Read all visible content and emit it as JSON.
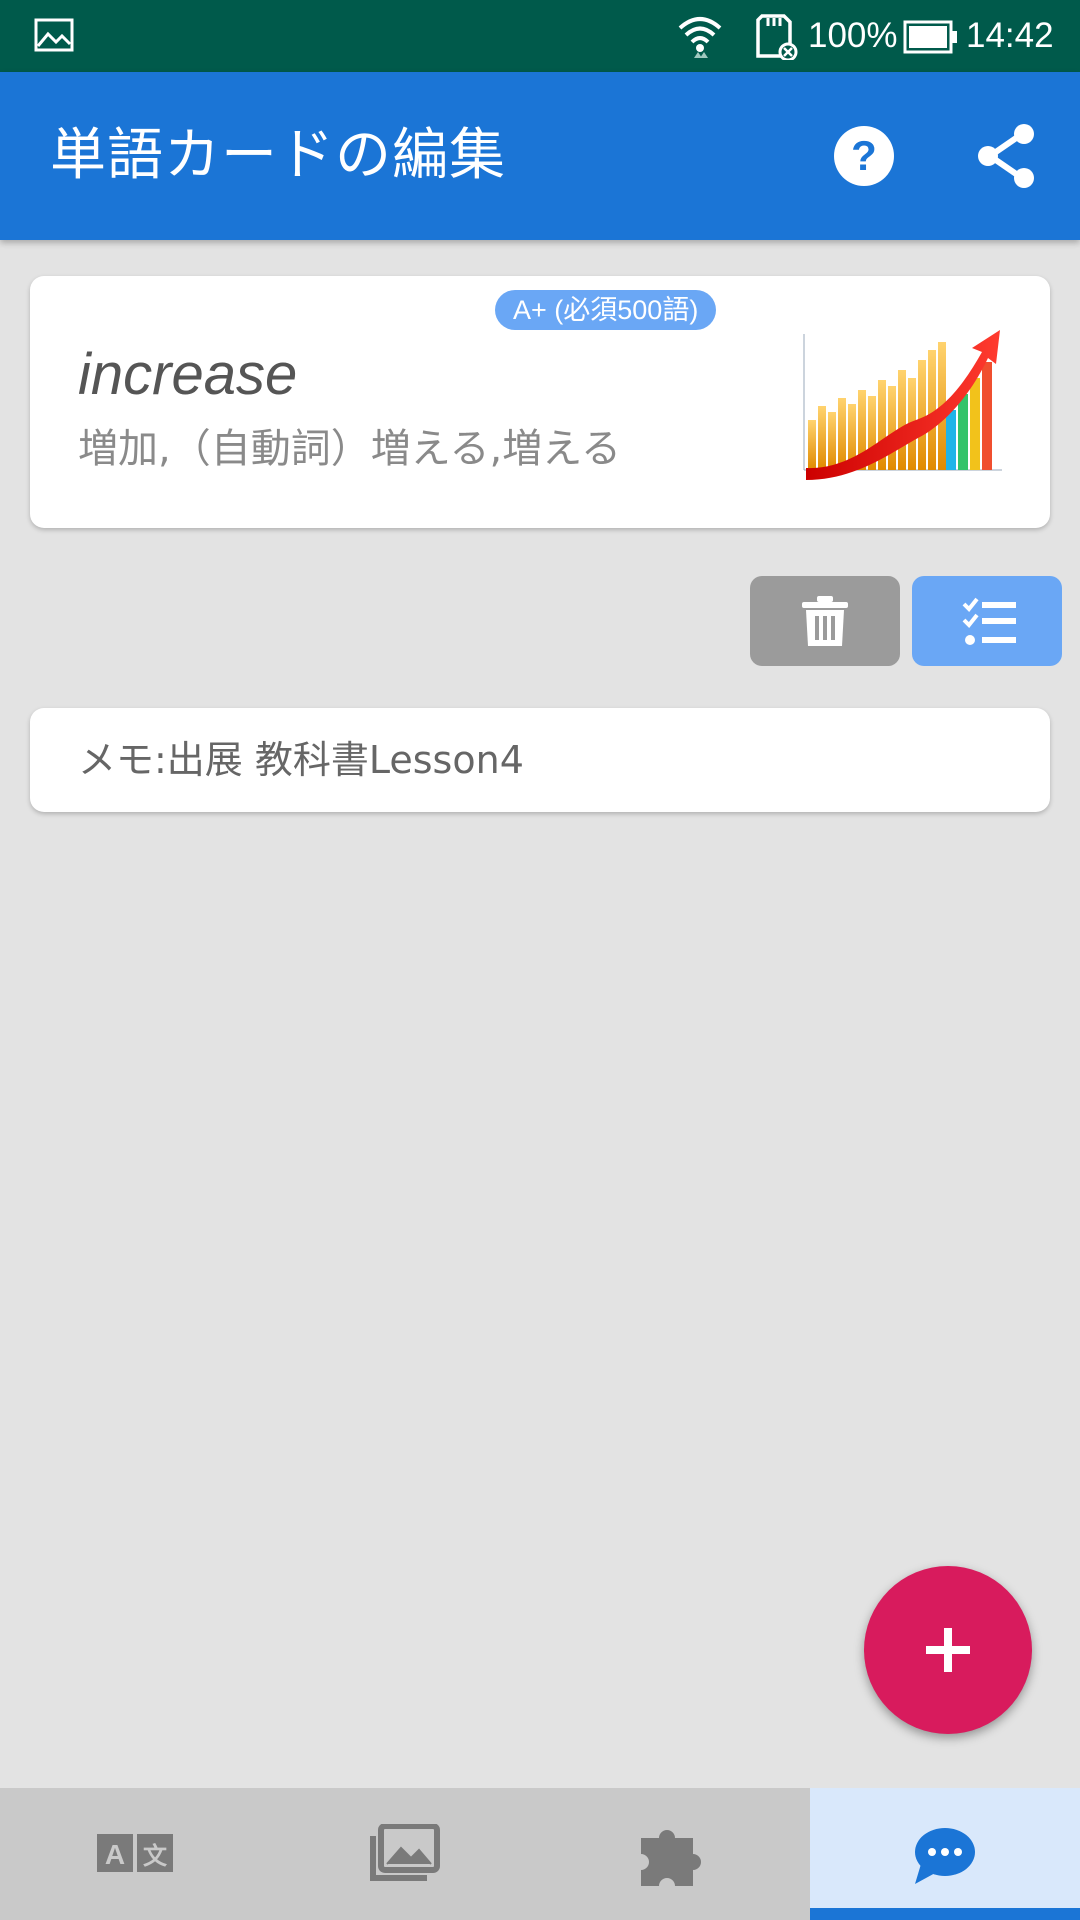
{
  "status_bar": {
    "battery_percent": "100%",
    "time": "14:42",
    "icons": [
      "gallery-icon",
      "wifi-icon",
      "sd-card-icon",
      "battery-icon"
    ]
  },
  "app_bar": {
    "title": "単語カードの編集",
    "icons": [
      "help-icon",
      "share-icon"
    ]
  },
  "word_card": {
    "badge": "A+ (必須500語)",
    "word": "increase",
    "meaning": "増加,（自動詞）増える,増える",
    "image": "growth-chart-image"
  },
  "actions": {
    "delete_icon": "trash-icon",
    "list_icon": "checklist-icon"
  },
  "memo": {
    "text": "メモ:出展 教科書Lesson4"
  },
  "fab": {
    "icon": "plus-icon"
  },
  "bottom_nav": {
    "items": [
      {
        "icon": "translate-icon",
        "active": false
      },
      {
        "icon": "photo-library-icon",
        "active": false
      },
      {
        "icon": "puzzle-icon",
        "active": false
      },
      {
        "icon": "chat-icon",
        "active": true
      }
    ]
  },
  "colors": {
    "status_bar": "#005a4b",
    "app_bar": "#1b75d6",
    "badge": "#6aa7f5",
    "fab": "#d81b5d",
    "delete": "#9b9b9b",
    "nav_active_bg": "#d9e8fb"
  }
}
